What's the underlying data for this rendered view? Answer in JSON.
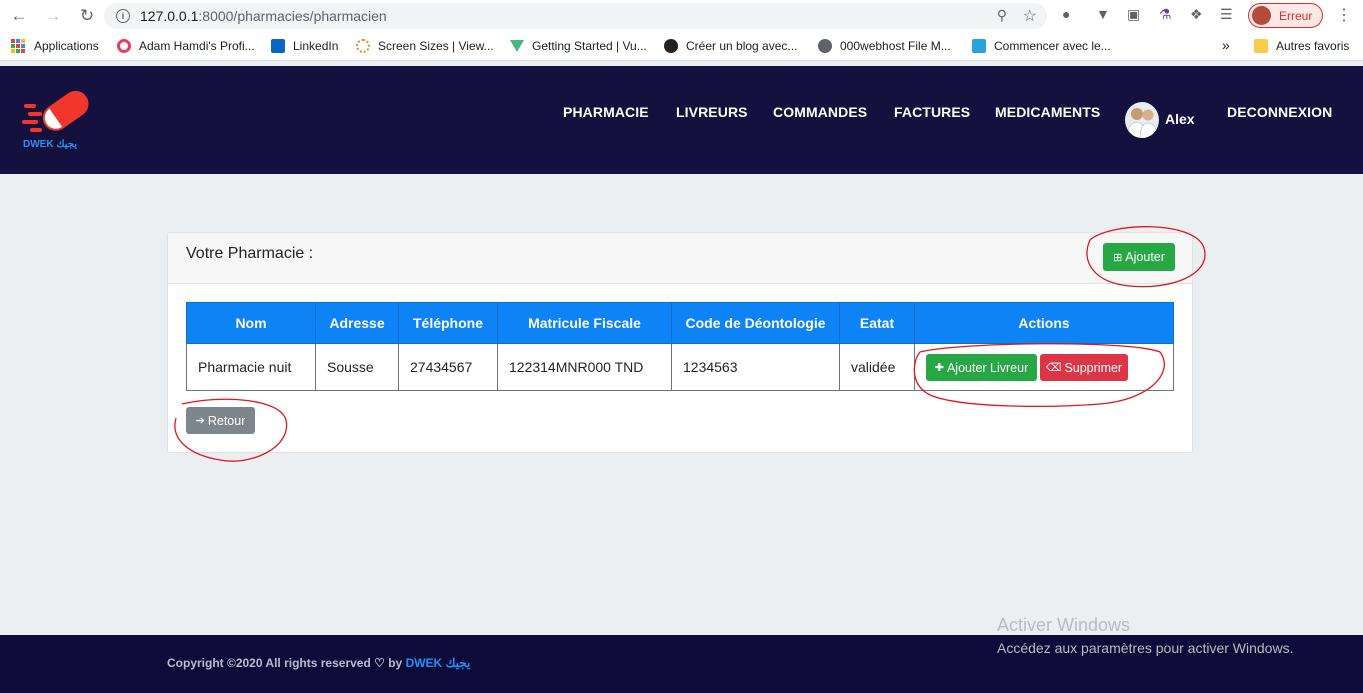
{
  "browser": {
    "url_host": "127.0.0.1",
    "url_path": ":8000/pharmacies/pharmacien",
    "profile_label": "Erreur",
    "bookmarks": [
      {
        "label": "Applications"
      },
      {
        "label": "Adam Hamdi's Profi..."
      },
      {
        "label": "LinkedIn"
      },
      {
        "label": "Screen Sizes | View..."
      },
      {
        "label": "Getting Started | Vu..."
      },
      {
        "label": "Créer un blog avec..."
      },
      {
        "label": "000webhost File M..."
      },
      {
        "label": "Commencer avec le..."
      }
    ],
    "overflow_label": "»",
    "other_bookmarks": "Autres favoris"
  },
  "header": {
    "logo_text": "DWEK يجيك",
    "nav": [
      "PHARMACIE",
      "LIVREURS",
      "COMMANDES",
      "FACTURES",
      "MEDICAMENTS"
    ],
    "user_name": "Alex",
    "logout": "DECONNEXION"
  },
  "card": {
    "title": "Votre Pharmacie :",
    "add_button": "Ajouter",
    "columns": [
      "Nom",
      "Adresse",
      "Téléphone",
      "Matricule Fiscale",
      "Code de Déontologie",
      "Eatat",
      "Actions"
    ],
    "rows": [
      {
        "nom": "Pharmacie nuit",
        "adresse": "Sousse",
        "telephone": "27434567",
        "matricule": "122314MNR000 TND",
        "code": "1234563",
        "etat": "validée",
        "action_add": "Ajouter Livreur",
        "action_delete": "Supprimer"
      }
    ],
    "back_button": "Retour"
  },
  "footer": {
    "text": "Copyright ©2020 All rights reserved ♡ by ",
    "brand": "DWEK يجيك"
  },
  "watermark": {
    "title": "Activer Windows",
    "subtitle": "Accédez aux paramètres pour activer Windows."
  },
  "colors": {
    "header_bg": "#14113f",
    "accent_blue": "#0d83f5",
    "success": "#28a745",
    "danger": "#dc3545",
    "annotation": "#e0161b"
  }
}
